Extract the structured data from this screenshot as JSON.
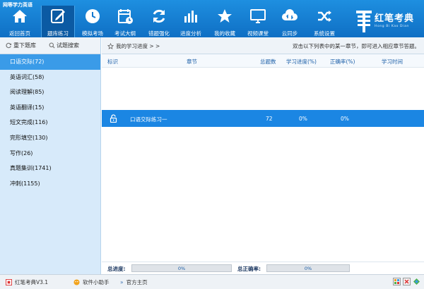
{
  "app_title": "网等学力英语",
  "toolbar": {
    "items": [
      {
        "label": "返回首页",
        "icon": "home-icon"
      },
      {
        "label": "题库练习",
        "icon": "edit-icon"
      },
      {
        "label": "模拟考场",
        "icon": "clock-icon"
      },
      {
        "label": "考试大纲",
        "icon": "calendar-icon"
      },
      {
        "label": "错题强化",
        "icon": "refresh-icon"
      },
      {
        "label": "进度分析",
        "icon": "bar-chart-icon"
      },
      {
        "label": "我的收藏",
        "icon": "star-icon"
      },
      {
        "label": "视频课堂",
        "icon": "monitor-icon"
      },
      {
        "label": "云同步",
        "icon": "cloud-sync-icon"
      },
      {
        "label": "系统设置",
        "icon": "shuffle-icon"
      }
    ],
    "active_index": 1
  },
  "logo": {
    "text": "红笔考典",
    "subtitle": "Hong Bi Kao Dian"
  },
  "left_tabs": {
    "reload": "重下题库",
    "search": "试题搜索"
  },
  "categories": [
    {
      "label": "口语交际(72)"
    },
    {
      "label": "英语词汇(58)"
    },
    {
      "label": "阅读理解(85)"
    },
    {
      "label": "英语翻译(15)"
    },
    {
      "label": "短文完成(116)"
    },
    {
      "label": "完形填空(130)"
    },
    {
      "label": "写作(26)"
    },
    {
      "label": "真题集训(1741)"
    },
    {
      "label": "冲刺(1155)"
    }
  ],
  "selected_category": 0,
  "main": {
    "breadcrumb": "我的学习进度 > >",
    "hint": "双击以下列表中的某一章节，即可进入相应章节答题。",
    "columns": {
      "mark": "标识",
      "chapter": "章节",
      "total": "总题数",
      "progress": "学习进度(%)",
      "accuracy": "正确率(%)",
      "time": "学习时间"
    },
    "rows": [
      {
        "chapter": "口语交际练习一",
        "total": "72",
        "progress": "0%",
        "accuracy": "0%",
        "time": "",
        "icon": "lock-icon"
      }
    ]
  },
  "summary": {
    "progress_label": "总进度:",
    "progress_value": "0%",
    "progress_fraction": 0,
    "accuracy_label": "总正确率:",
    "accuracy_value": "0%",
    "accuracy_fraction": 0
  },
  "statusbar": {
    "version": "红笔考典V3.1",
    "assistant": "软件小助手",
    "homepage": "官方主页"
  },
  "colors": {
    "accent": "#1b86e3",
    "toolbar": "#1e8fe0",
    "sidebar": "#d7eafa"
  }
}
